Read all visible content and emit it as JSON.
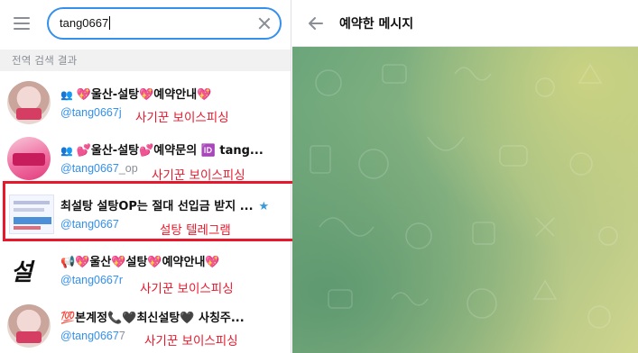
{
  "search": {
    "query": "tang0667"
  },
  "results_header": "전역 검색 결과",
  "results": [
    {
      "title": "💖울산-설탕💖예약안내💖",
      "group": true,
      "handle": "@tang0667j",
      "handle_dim": "",
      "note": "사기꾼 보이스피싱",
      "starred": false,
      "avatar": "avatar-a"
    },
    {
      "title": "💕울산-설탕💕예약문의 🆔 tang...",
      "group": true,
      "handle": "@tang0667",
      "handle_dim": "_op",
      "note": "사기꾼 보이스피싱",
      "starred": false,
      "avatar": "avatar-b"
    },
    {
      "title": "최설탕 설탕OP는 절대 선입금 받지 ...",
      "group": false,
      "handle": "@tang0667",
      "handle_dim": "",
      "note": "설탕 텔레그램",
      "starred": true,
      "avatar": "avatar-c"
    },
    {
      "title": "📢💖울산💖설탕💖예약안내💖",
      "group": false,
      "handle": "@tang0667r",
      "handle_dim": "",
      "note": "사기꾼 보이스피싱",
      "starred": false,
      "avatar": "avatar-d",
      "avatar_text": "설탕"
    },
    {
      "title": "💯본계정📞🖤최신설탕🖤 사칭주...",
      "group": false,
      "handle": "@tang0667",
      "handle_dim": "7",
      "note": "사기꾼 보이스피싱",
      "starred": false,
      "avatar": "avatar-a"
    }
  ],
  "chat": {
    "title": "예약한 메시지"
  },
  "colors": {
    "accent": "#3390ec",
    "annotation": "#e8182c"
  },
  "icons": {
    "menu": "menu-icon",
    "clear": "close-icon",
    "back": "arrow-left-icon",
    "group": "group-icon",
    "star": "star-icon"
  }
}
